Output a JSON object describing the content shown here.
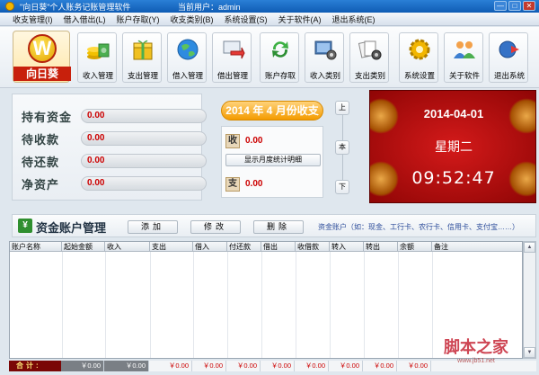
{
  "window": {
    "title": "\"向日葵\"个人账务记账管理软件",
    "user_label": "当前用户：admin",
    "min": "—",
    "max": "□",
    "close": "✕"
  },
  "menu": [
    "收支管理(I)",
    "借入借出(L)",
    "账户存取(Y)",
    "收支类别(B)",
    "系统设置(S)",
    "关于软件(A)",
    "退出系统(E)"
  ],
  "logo": {
    "glyph": "W",
    "name": "向日葵"
  },
  "toolbar": [
    {
      "label": "收入管理",
      "icon": "money-stack-icon"
    },
    {
      "label": "支出管理",
      "icon": "gift-box-icon"
    },
    {
      "label": "借入管理",
      "icon": "globe-icon"
    },
    {
      "label": "借出管理",
      "icon": "transfer-arrow-icon"
    },
    {
      "label": "账户存取",
      "icon": "recycle-arrows-icon"
    },
    {
      "label": "收入类别",
      "icon": "monitor-gear-icon"
    },
    {
      "label": "支出类别",
      "icon": "cards-gear-icon"
    },
    {
      "label": "系统设置",
      "icon": "gear-icon"
    },
    {
      "label": "关于软件",
      "icon": "users-icon"
    },
    {
      "label": "退出系统",
      "icon": "exit-icon"
    }
  ],
  "summary": [
    {
      "label": "持有资金",
      "value": "0.00"
    },
    {
      "label": "待收款",
      "value": "0.00"
    },
    {
      "label": "待还款",
      "value": "0.00"
    },
    {
      "label": "净资产",
      "value": "0.00"
    }
  ],
  "period": {
    "year": "2014",
    "year_unit": "年",
    "month": "4",
    "month_suffix": "月份收支"
  },
  "monthly": {
    "income_tag": "收",
    "income": "0.00",
    "detail_button": "显示月度统计明细",
    "expense_tag": "支",
    "expense": "0.00"
  },
  "nav": {
    "up": "上",
    "current": "本",
    "down": "下"
  },
  "calendar": {
    "date": "2014-04-01",
    "weekday": "星期二",
    "time": "09:52:47"
  },
  "accounts": {
    "title": "资金账户管理",
    "add": "添加",
    "edit": "修改",
    "delete": "删除",
    "hint": "资金账户（如：现金、工行卡、农行卡、信用卡、支付宝……）"
  },
  "table": {
    "columns": [
      "账户名称",
      "起始金额",
      "收入",
      "支出",
      "借入",
      "付还款",
      "借出",
      "收借款",
      "转入",
      "转出",
      "余额",
      "备注"
    ]
  },
  "totals": {
    "label": "合计:",
    "values": [
      "￥0.00",
      "￥0.00",
      "￥0.00",
      "￥0.00",
      "￥0.00",
      "￥0.00",
      "￥0.00",
      "￥0.00",
      "￥0.00",
      "￥0.00"
    ]
  },
  "watermark": {
    "text": "脚本之家",
    "sub": "www.jb51.net"
  }
}
